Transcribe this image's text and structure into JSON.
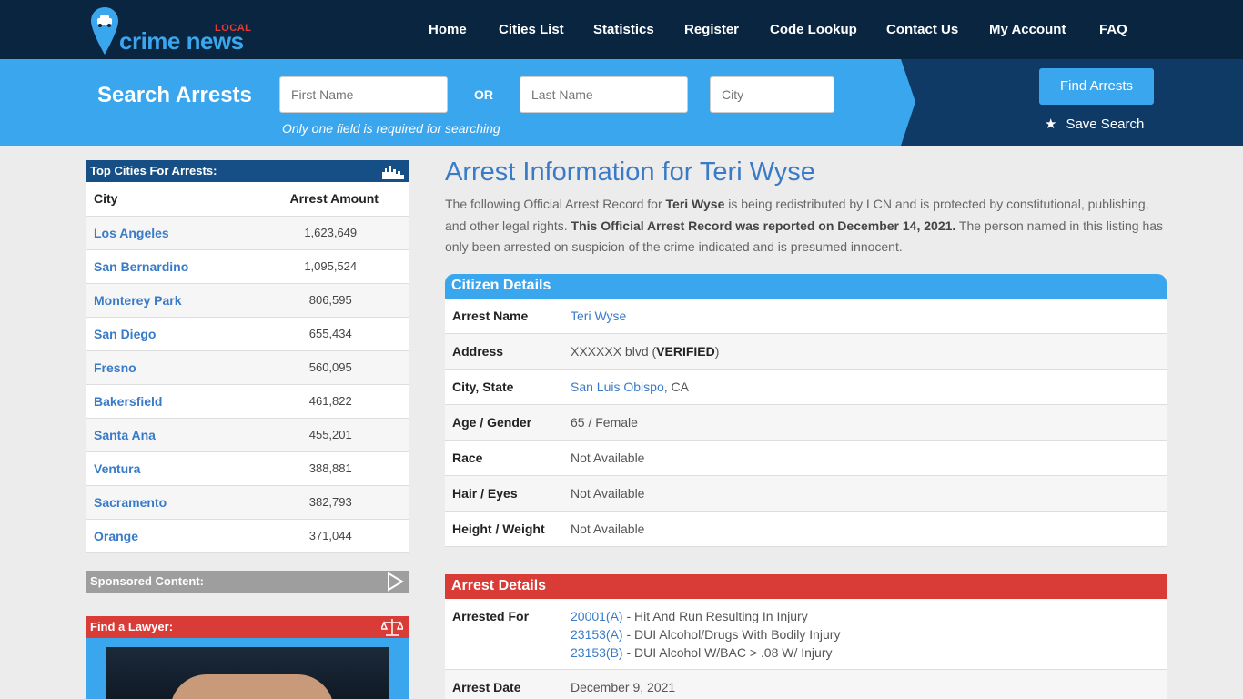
{
  "brand": {
    "local": "LOCAL",
    "name": "crime news"
  },
  "nav": [
    "Home",
    "Cities List",
    "Statistics",
    "Register",
    "Code Lookup",
    "Contact Us",
    "My Account",
    "FAQ"
  ],
  "search": {
    "title": "Search Arrests",
    "first_placeholder": "First Name",
    "or": "OR",
    "last_placeholder": "Last Name",
    "city_placeholder": "City",
    "hint": "Only one field is required for searching",
    "find_label": "Find Arrests",
    "save_label": "Save Search"
  },
  "sidebar": {
    "title": "Top Cities For Arrests:",
    "col_city": "City",
    "col_amount": "Arrest Amount",
    "rows": [
      {
        "city": "Los Angeles",
        "amount": "1,623,649"
      },
      {
        "city": "San Bernardino",
        "amount": "1,095,524"
      },
      {
        "city": "Monterey Park",
        "amount": "806,595"
      },
      {
        "city": "San Diego",
        "amount": "655,434"
      },
      {
        "city": "Fresno",
        "amount": "560,095"
      },
      {
        "city": "Bakersfield",
        "amount": "461,822"
      },
      {
        "city": "Santa Ana",
        "amount": "455,201"
      },
      {
        "city": "Ventura",
        "amount": "388,881"
      },
      {
        "city": "Sacramento",
        "amount": "382,793"
      },
      {
        "city": "Orange",
        "amount": "371,044"
      }
    ],
    "sponsored": "Sponsored Content:",
    "lawyer": "Find a Lawyer:"
  },
  "main": {
    "title": "Arrest Information for Teri Wyse",
    "intro": {
      "p1": "The following Official Arrest Record for ",
      "name": "Teri Wyse",
      "p2": " is being redistributed by LCN and is protected by constitutional, publishing, and other legal rights. ",
      "bold": "This Official Arrest Record was reported on December 14, 2021.",
      "p3": " The person named in this listing has only been arrested on suspicion of the crime indicated and is presumed innocent."
    },
    "citizen_head": "Citizen Details",
    "citizen": {
      "name_label": "Arrest Name",
      "name": "Teri Wyse",
      "address_label": "Address",
      "address": "XXXXXX blvd (",
      "verified": "VERIFIED",
      "address_end": ")",
      "city_label": "City, State",
      "city": "San Luis Obispo",
      "state": ", CA",
      "age_label": "Age / Gender",
      "age": "65 / Female",
      "race_label": "Race",
      "race": "Not Available",
      "hair_label": "Hair / Eyes",
      "hair": "Not Available",
      "height_label": "Height / Weight",
      "height": "Not Available"
    },
    "arrest_head": "Arrest Details",
    "arrest": {
      "for_label": "Arrested For",
      "charges": [
        {
          "code": "20001(A)",
          "desc": " - Hit And Run Resulting In Injury"
        },
        {
          "code": "23153(A)",
          "desc": " - DUI Alcohol/Drugs With Bodily Injury"
        },
        {
          "code": "23153(B)",
          "desc": " - DUI Alcohol W/BAC > .08 W/ Injury"
        }
      ],
      "date_label": "Arrest Date",
      "date": "December 9, 2021"
    }
  }
}
